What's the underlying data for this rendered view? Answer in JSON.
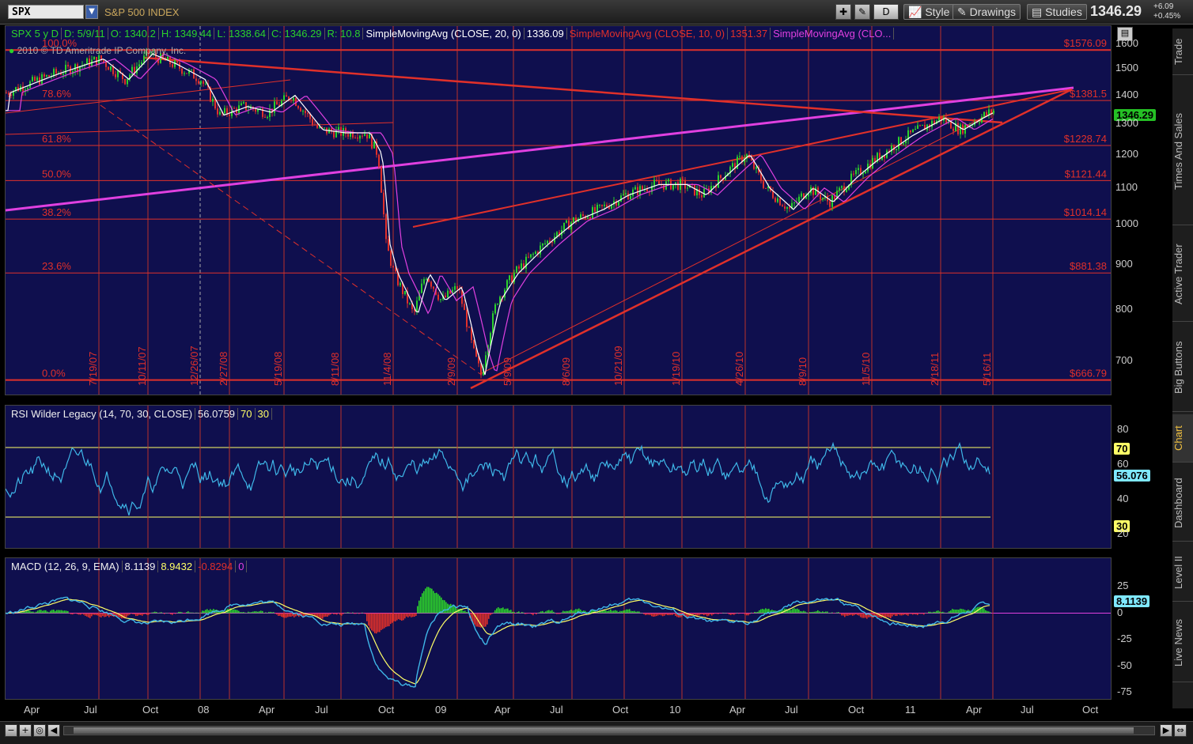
{
  "toolbar": {
    "symbol": "SPX",
    "index_name": "S&P 500 INDEX",
    "period_button": "D",
    "style_label": "Style",
    "drawings_label": "Drawings",
    "studies_label": "Studies",
    "last_price": "1346.29",
    "change_abs": "+6.09",
    "change_pct": "+0.45%"
  },
  "price_panel": {
    "header": {
      "symbol": "SPX 5 y D",
      "date": "D: 5/9/11",
      "open": "O: 1340.2",
      "high": "H: 1349.44",
      "low": "L: 1338.64",
      "close": "C: 1346.29",
      "range": "R: 10.8",
      "sma20_label": "SimpleMovingAvg (CLOSE, 20, 0)",
      "sma20_value": "1336.09",
      "sma10_label": "SimpleMovingAvg (CLOSE, 10, 0)",
      "sma10_value": "1351.37",
      "sma50_label": "SimpleMovingAvg (CLO..."
    },
    "copyright": "2010 © TD Ameritrade IP Company, Inc.",
    "current_price_tag": "1346.29",
    "fib_levels": [
      {
        "pct": "100.0%",
        "price": "$1576.09",
        "value": 1576.09
      },
      {
        "pct": "78.6%",
        "price": "$1381.5",
        "value": 1381.5
      },
      {
        "pct": "61.8%",
        "price": "$1228.74",
        "value": 1228.74
      },
      {
        "pct": "50.0%",
        "price": "$1121.44",
        "value": 1121.44
      },
      {
        "pct": "38.2%",
        "price": "$1014.14",
        "value": 1014.14
      },
      {
        "pct": "23.6%",
        "price": "$881.38",
        "value": 881.38
      },
      {
        "pct": "0.0%",
        "price": "$666.79",
        "value": 666.79
      }
    ],
    "y_ticks": [
      "1600",
      "1500",
      "1400",
      "1300",
      "1200",
      "1100",
      "1000",
      "900",
      "800",
      "700"
    ],
    "date_markers": [
      "7/19/07",
      "10/11/07",
      "12/26/07",
      "2/27/08",
      "5/19/08",
      "8/11/08",
      "11/4/08",
      "2/9/09",
      "5/9/09",
      "8/6/09",
      "10/21/09",
      "1/19/10",
      "4/26/10",
      "8/9/10",
      "11/5/10",
      "2/18/11",
      "5/16/11"
    ]
  },
  "rsi_panel": {
    "label": "RSI Wilder Legacy (14, 70, 30, CLOSE)",
    "value": "56.0759",
    "overbought": "70",
    "oversold": "30",
    "value_tag": "56.076",
    "y_ticks": [
      "80",
      "60",
      "40",
      "20"
    ]
  },
  "macd_panel": {
    "label": "MACD (12, 26, 9, EMA)",
    "value": "8.1139",
    "avg": "8.9432",
    "diff": "-0.8294",
    "zero": "0",
    "value_tag": "8.1139",
    "y_ticks": [
      "25",
      "0",
      "-25",
      "-50",
      "-75"
    ]
  },
  "x_axis": [
    "Apr",
    "Jul",
    "Oct",
    "08",
    "Apr",
    "Jul",
    "Oct",
    "09",
    "Apr",
    "Jul",
    "Oct",
    "10",
    "Apr",
    "Jul",
    "Oct",
    "11",
    "Apr",
    "Jul",
    "Oct"
  ],
  "side_tabs": [
    "Trade",
    "Times And Sales",
    "Active Trader",
    "Big Buttons",
    "Chart",
    "Dashboard",
    "Level II",
    "Live News"
  ],
  "colors": {
    "panel_bg": "#0f0f4e",
    "fib_red": "#e0302a",
    "trend_magenta": "#e040e0",
    "rsi_cyan": "#3fb7e8",
    "macd_green": "#2bd12b",
    "tag_green": "#25c025",
    "tag_yellow": "#ffff66",
    "tag_cyan": "#7fe8ff"
  }
}
